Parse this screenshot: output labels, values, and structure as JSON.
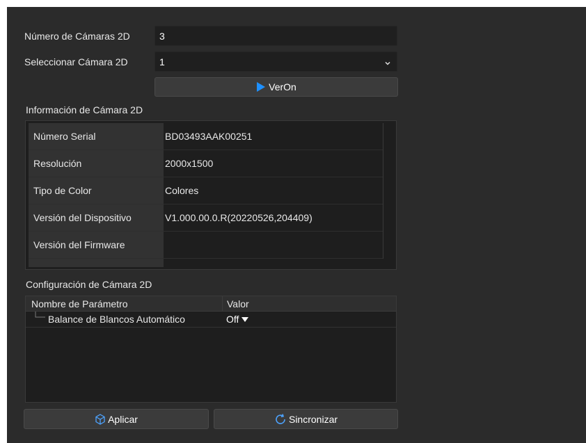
{
  "camera_count": {
    "label": "Número de Cámaras 2D",
    "value": "3"
  },
  "camera_select": {
    "label": "Seleccionar Cámara 2D",
    "value": "1"
  },
  "view_button": {
    "label": "VerOn"
  },
  "info_section": {
    "title": "Información de Cámara 2D",
    "rows": [
      {
        "key": "Número Serial",
        "value": "BD03493AAK00251"
      },
      {
        "key": "Resolución",
        "value": "2000x1500"
      },
      {
        "key": "Tipo de Color",
        "value": "Colores"
      },
      {
        "key": "Versión del Dispositivo",
        "value": "V1.000.00.0.R(20220526,204409)"
      },
      {
        "key": "Versión del Firmware",
        "value": ""
      }
    ]
  },
  "config_section": {
    "title": "Configuración de Cámara 2D",
    "columns": [
      "Nombre de Parámetro",
      "Valor"
    ],
    "params": [
      {
        "name": "Balance de Blancos Automático",
        "value": "Off"
      }
    ]
  },
  "apply_button": {
    "label": "Aplicar"
  },
  "sync_button": {
    "label": "Sincronizar"
  },
  "colors": {
    "panel_bg": "#2b2b2b",
    "accent": "#1e90ff",
    "field_bg": "#1f1f1f"
  },
  "icons": [
    "play-icon",
    "chevron-down-icon",
    "cube-icon",
    "refresh-icon",
    "dropdown-arrow-icon",
    "tree-branch-icon"
  ]
}
